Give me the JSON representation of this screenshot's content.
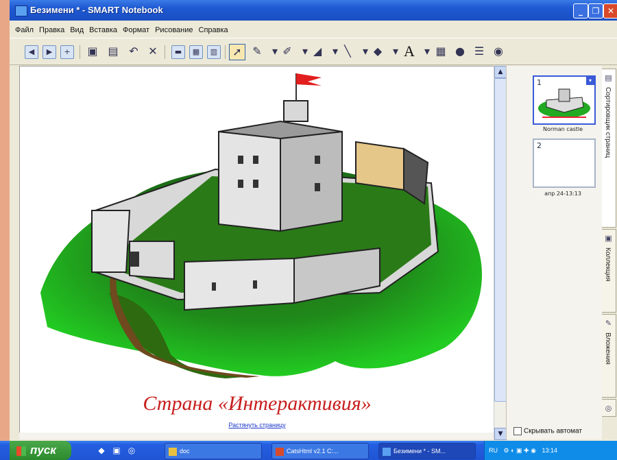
{
  "window": {
    "title": "Безимени * - SMART Notebook"
  },
  "menu": [
    "Файл",
    "Правка",
    "Вид",
    "Вставка",
    "Формат",
    "Рисование",
    "Справка"
  ],
  "toolbar": {
    "tools": [
      "back",
      "forward",
      "add-page",
      "save",
      "paste",
      "undo",
      "delete",
      "screen",
      "fullscreen",
      "capture",
      "select",
      "pen",
      "creative-pen",
      "eraser",
      "line",
      "shapes",
      "text",
      "table",
      "magic-pen",
      "properties",
      "more"
    ],
    "text_tool_label": "A"
  },
  "canvas": {
    "caption": "Страна «Интерактивия»",
    "link": "Растянуть страницу"
  },
  "sorter": {
    "pages": [
      {
        "number": "1",
        "caption": "Norman castle",
        "selected": true
      },
      {
        "number": "2",
        "caption": "апр 24-13:13",
        "selected": false
      }
    ],
    "autohide_label": "Скрывать автомат"
  },
  "side_tabs": [
    "Сортировщик страниц",
    "Коллекция",
    "Вложения"
  ],
  "taskbar": {
    "start_label": "пуск",
    "tasks": [
      {
        "label": "doc"
      },
      {
        "label": "CatsHtml v2.1 C:..."
      },
      {
        "label": "Безимени * - SM..."
      }
    ],
    "lang": "RU",
    "clock": "13:14"
  }
}
